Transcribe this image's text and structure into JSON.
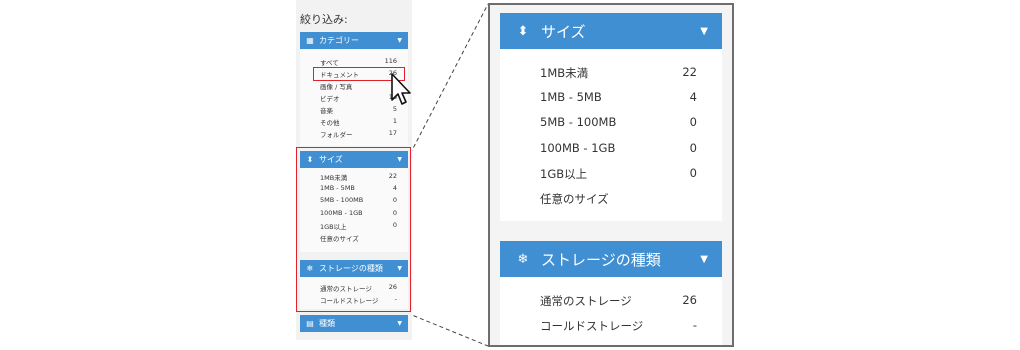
{
  "filter_title": "絞り込み:",
  "category": {
    "header": "カテゴリー",
    "items": [
      {
        "label": "すべて",
        "count": "116"
      },
      {
        "label": "ドキュメント",
        "count": "26"
      },
      {
        "label": "画像 / 写真",
        "count": "5"
      },
      {
        "label": "ビデオ",
        "count": "16"
      },
      {
        "label": "音楽",
        "count": "5"
      },
      {
        "label": "その他",
        "count": "1"
      },
      {
        "label": "フォルダー",
        "count": "17"
      }
    ]
  },
  "size": {
    "header": "サイズ",
    "items": [
      {
        "label": "1MB未満",
        "count": "22"
      },
      {
        "label": "1MB - 5MB",
        "count": "4"
      },
      {
        "label": "5MB - 100MB",
        "count": "0"
      },
      {
        "label": "100MB - 1GB",
        "count": "0"
      },
      {
        "label": "1GB以上",
        "count": "0"
      },
      {
        "label": "任意のサイズ",
        "count": ""
      }
    ]
  },
  "storage": {
    "header": "ストレージの種類",
    "items": [
      {
        "label": "通常のストレージ",
        "count": "26"
      },
      {
        "label": "コールドストレージ",
        "count": "-"
      }
    ]
  },
  "type": {
    "header": "種類"
  },
  "colors": {
    "header_bg": "#3f8fd2",
    "highlight": "#e0202a"
  },
  "icons": {
    "category": "grid-icon",
    "size": "sort-arrows-icon",
    "storage": "snowflake-icon",
    "type": "document-icon",
    "chevron": "chevron-down-icon",
    "cursor": "mouse-pointer-icon"
  }
}
